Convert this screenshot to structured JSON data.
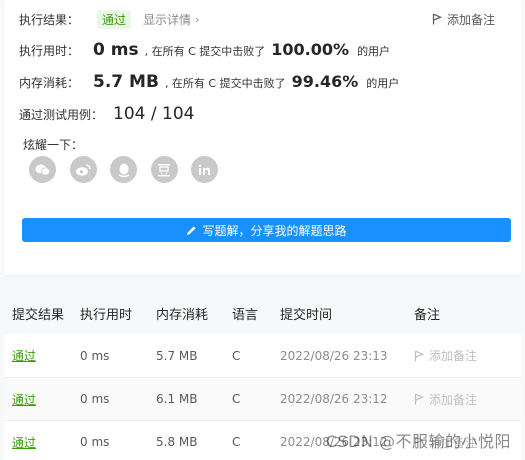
{
  "summary": {
    "result_label": "执行结果：",
    "result_value": "通过",
    "details_link": "显示详情",
    "add_note": "添加备注",
    "runtime": {
      "label": "执行用时：",
      "value": "0 ms",
      "mid": ", 在所有 C 提交中击败了",
      "percent": "100.00%",
      "tail": "的用户"
    },
    "memory": {
      "label": "内存消耗：",
      "value": "5.7 MB",
      "mid": ", 在所有 C 提交中击败了",
      "percent": "99.46%",
      "tail": "的用户"
    },
    "testcases": {
      "label": "通过测试用例：",
      "value": "104 / 104"
    },
    "share_label": "炫耀一下：",
    "share_icons": [
      "wechat-icon",
      "weibo-icon",
      "qq-icon",
      "douban-icon",
      "linkedin-icon"
    ],
    "write_solution_button": "写题解，分享我的解题思路"
  },
  "table": {
    "headers": [
      "提交结果",
      "执行用时",
      "内存消耗",
      "语言",
      "提交时间",
      "备注"
    ],
    "rows": [
      {
        "result": "通过",
        "runtime": "0 ms",
        "memory": "5.7 MB",
        "language": "C",
        "time": "2022/08/26 23:13",
        "note": "添加备注"
      },
      {
        "result": "通过",
        "runtime": "0 ms",
        "memory": "6.1 MB",
        "language": "C",
        "time": "2022/08/26 23:12",
        "note": "添加备注"
      },
      {
        "result": "通过",
        "runtime": "0 ms",
        "memory": "5.8 MB",
        "language": "C",
        "time": "2022/08/26 23:12",
        "note": "添加备注"
      }
    ]
  },
  "watermark": "CSDN @不服输的小悦阳",
  "colors": {
    "accent": "#1890ff",
    "success": "#389e0d",
    "badge_bg": "#eaf7e6",
    "icon_grey": "#c9c9c9"
  }
}
